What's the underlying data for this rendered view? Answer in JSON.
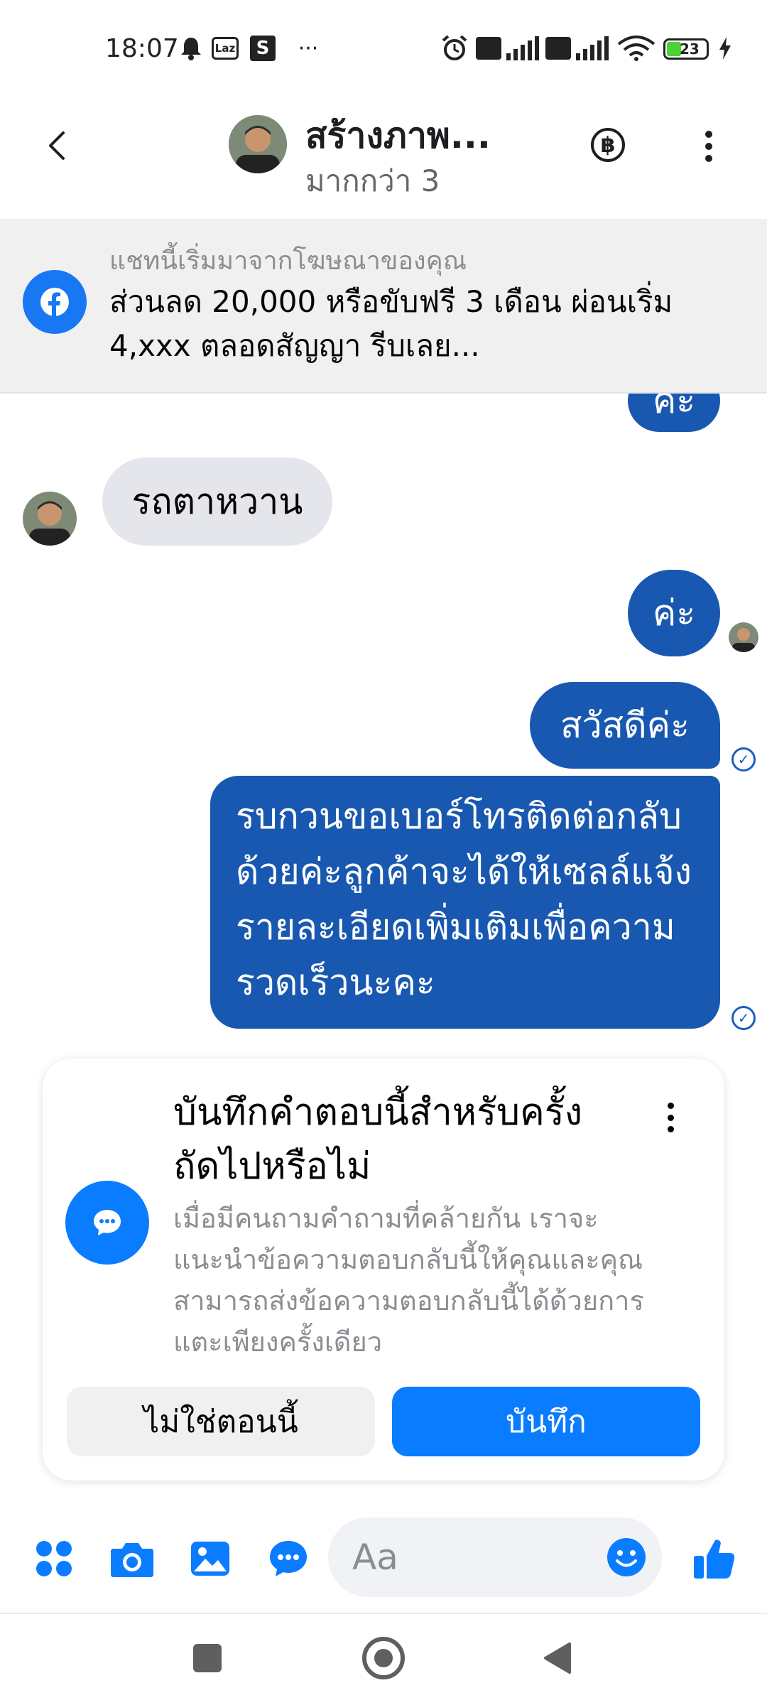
{
  "status_bar": {
    "time": "18:07",
    "laz_label": "Laz",
    "s_label": "S",
    "more_label": "···",
    "battery_label": "23"
  },
  "header": {
    "title": "สร้างภาพ...",
    "subtitle": "มากกว่า 3",
    "baht_label": "฿"
  },
  "ad_banner": {
    "label": "แชทนี้เริ่มมาจากโฆษณาของคุณ",
    "text": "ส่วนลด 20,000 หรือขับฟรี 3 เดือน ผ่อนเริ่ม 4,xxx ตลอดสัญญา รีบเลย...",
    "brand_icon": "facebook-icon",
    "brand_color": "#1877f2"
  },
  "messages": {
    "partial_out": "ค่ะ",
    "incoming_1": "รถตาหวาน",
    "outgoing_1": "ค่ะ",
    "outgoing_2": "สวัสดีค่ะ",
    "outgoing_3": "รบกวนขอเบอร์โทรติดต่อกลับด้วยค่ะลูกค้าจะได้ให้เซลล์แจ้งรายละเอียดเพิ่มเติมเพื่อความรวดเร็วนะคะ"
  },
  "save_card": {
    "title": "บันทึกคำตอบนี้สำหรับครั้งถัดไปหรือไม่",
    "description": "เมื่อมีคนถามคำถามที่คล้ายกัน เราจะแนะนำข้อความตอบกลับนี้ให้คุณและคุณสามารถส่งข้อความตอบกลับนี้ได้ด้วยการแตะเพียงครั้งเดียว",
    "not_now_label": "ไม่ใช่ตอนนี้",
    "save_label": "บันทึก"
  },
  "composer": {
    "placeholder": "Aa"
  },
  "colors": {
    "accent": "#0a7cff",
    "outgoing_bubble": "#1958b0",
    "incoming_bubble": "#e4e6eb"
  }
}
